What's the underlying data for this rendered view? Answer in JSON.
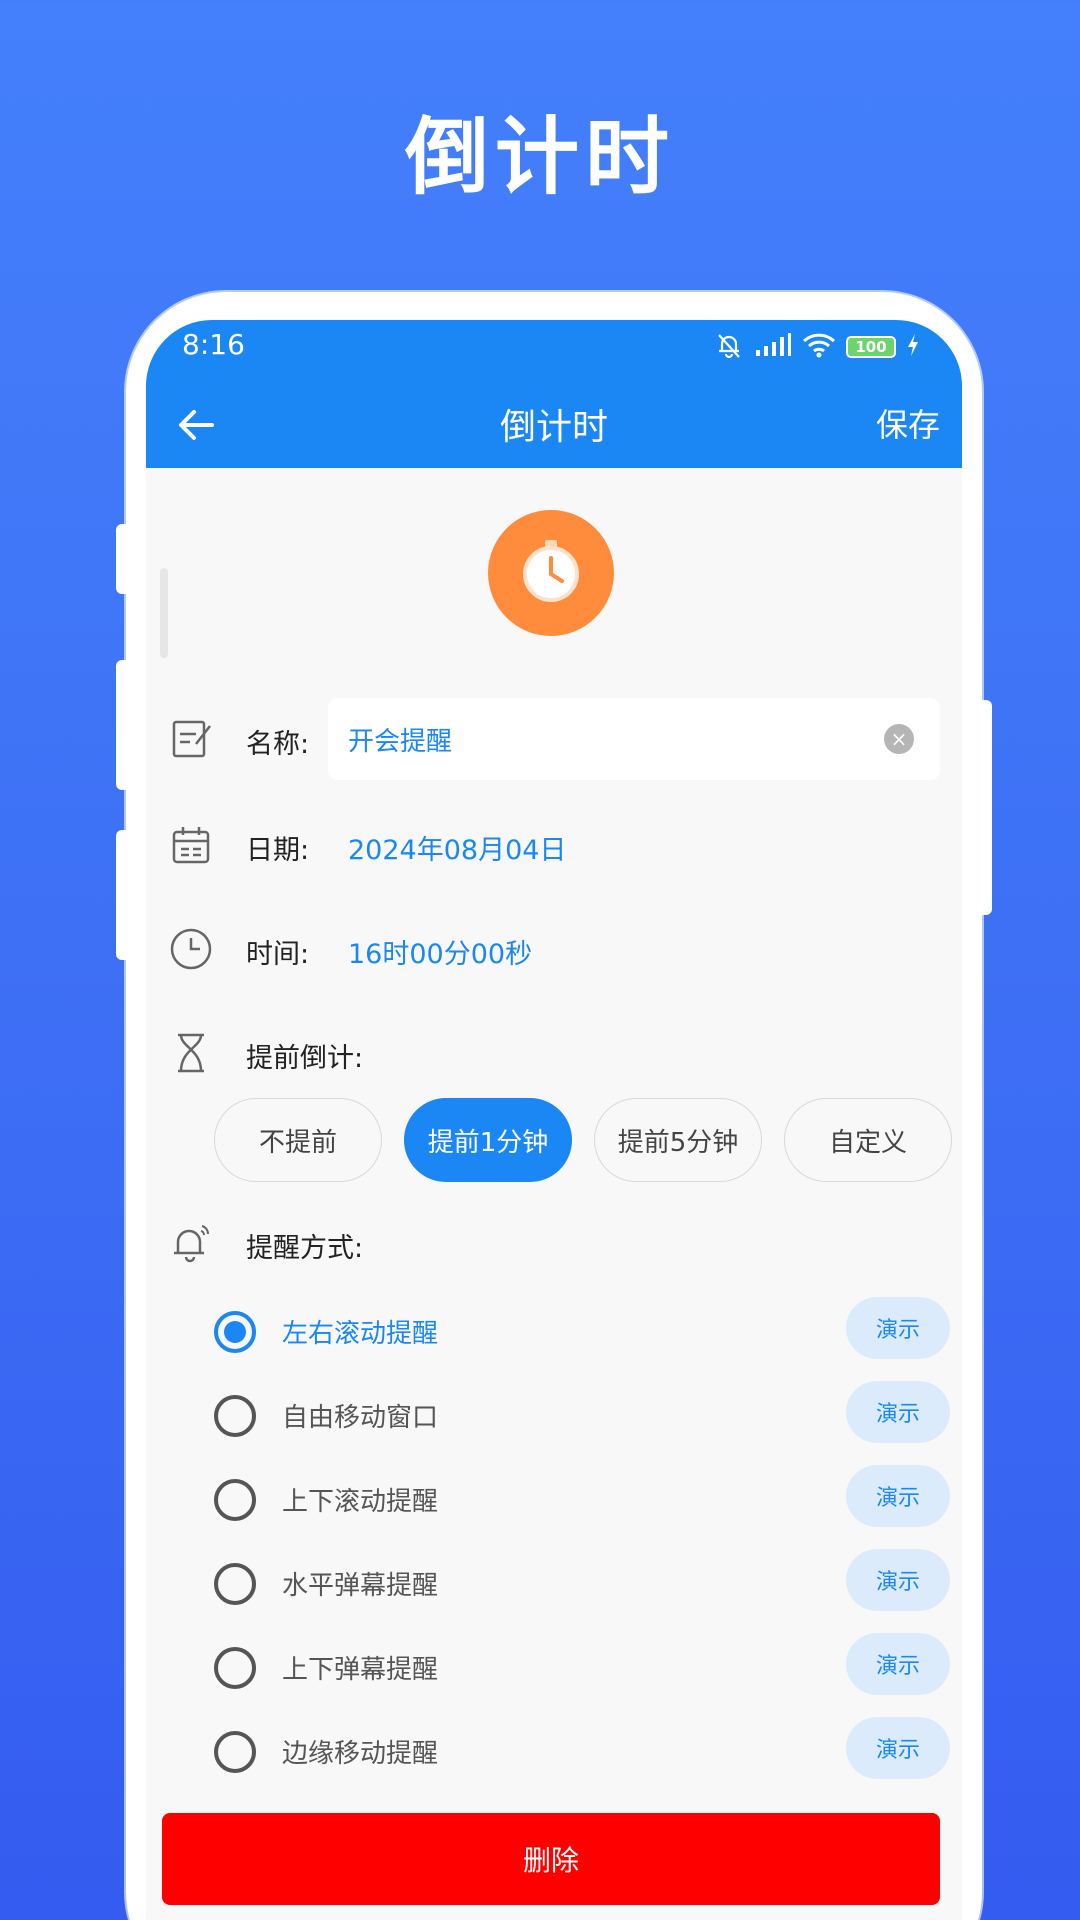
{
  "promo": {
    "title": "倒计时"
  },
  "status_bar": {
    "time": "8:16",
    "battery": "100"
  },
  "nav": {
    "title": "倒计时",
    "save_label": "保存"
  },
  "form": {
    "name_label": "名称:",
    "name_value": "开会提醒",
    "date_label": "日期:",
    "date_value": "2024年08月04日",
    "time_label": "时间:",
    "time_value": "16时00分00秒",
    "advance_label": "提前倒计:",
    "advance_options": [
      "不提前",
      "提前1分钟",
      "提前5分钟",
      "自定义"
    ],
    "advance_selected": "提前1分钟",
    "reminder_label": "提醒方式:",
    "reminder_options": [
      "左右滚动提醒",
      "自由移动窗口",
      "上下滚动提醒",
      "水平弹幕提醒",
      "上下弹幕提醒",
      "边缘移动提醒"
    ],
    "reminder_selected": "左右滚动提醒",
    "demo_label": "演示",
    "delete_label": "删除"
  },
  "colors": {
    "primary": "#1a87f5",
    "timer_badge": "#ff8c3c",
    "delete": "#ff0000",
    "demo_bg": "#dcebfb"
  },
  "icons": [
    "back-arrow-icon",
    "bell-muted-icon",
    "signal-icon",
    "wifi-icon",
    "battery-icon",
    "charging-icon",
    "stopwatch-icon",
    "edit-note-icon",
    "calendar-icon",
    "clock-icon",
    "hourglass-icon",
    "ringing-bell-icon",
    "clear-icon"
  ]
}
